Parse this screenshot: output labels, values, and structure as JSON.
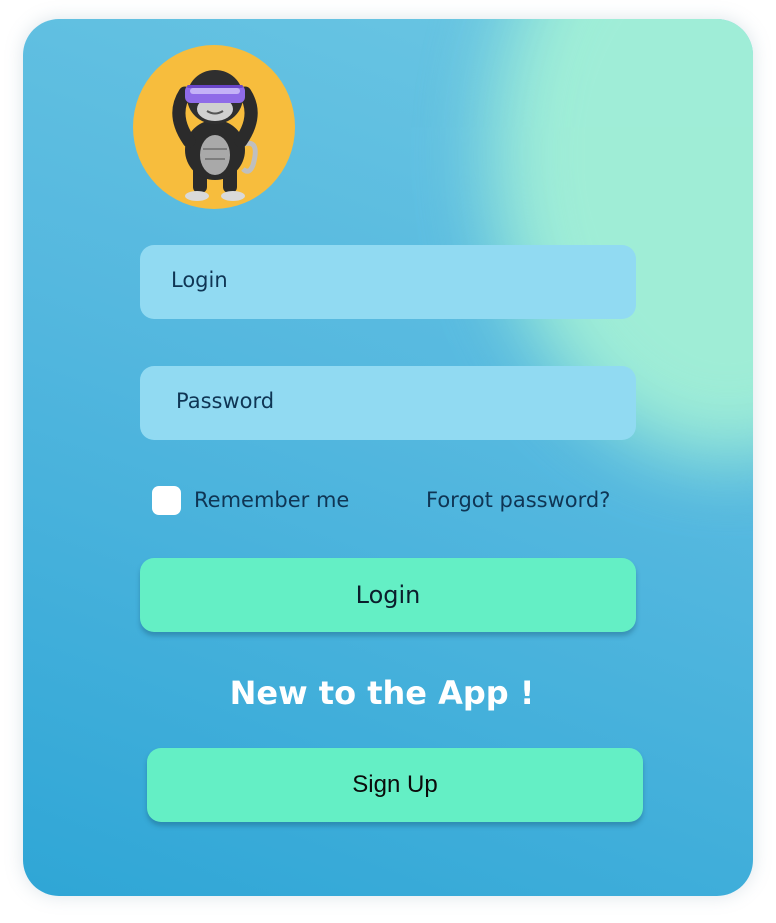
{
  "login_form": {
    "login_placeholder": "Login",
    "password_placeholder": "Password",
    "remember_label": "Remember me",
    "remember_checked": false,
    "forgot_label": "Forgot password?",
    "login_button": "Login",
    "new_to_app": "New to the App !",
    "signup_button": "Sign Up"
  },
  "colors": {
    "card_top": "#6cc7e3",
    "card_bottom": "#2fa6d6",
    "glow": "#a3f0d6",
    "field_bg": "#91daf2",
    "button_bg": "#64efc5",
    "avatar_bg": "#f7bd3d",
    "text_dark": "#0f3554"
  },
  "icons": {
    "avatar": "gorilla-vr-headset-avatar"
  }
}
